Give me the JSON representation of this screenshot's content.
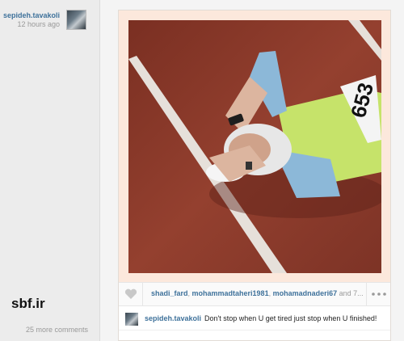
{
  "post": {
    "username": "sepideh.tavakoli",
    "timestamp": "12 hours ago"
  },
  "watermark": "sbf.ir",
  "likes": {
    "users": [
      "shadi_fard",
      "mohammadtaheri1981",
      "mohamadnaderi67"
    ],
    "more": "and 7..."
  },
  "caption": {
    "username": "sepideh.tavakoli",
    "text": "Don't stop when U get tired just stop when U finished!"
  },
  "comments": {
    "more_label": "25 more comments"
  },
  "bib_number": "653",
  "icons": {
    "like": "heart-icon",
    "more": "more-dots-icon"
  },
  "colors": {
    "link": "#3f729b",
    "frame": "#fce8dc",
    "track": "#8d3a2b"
  }
}
